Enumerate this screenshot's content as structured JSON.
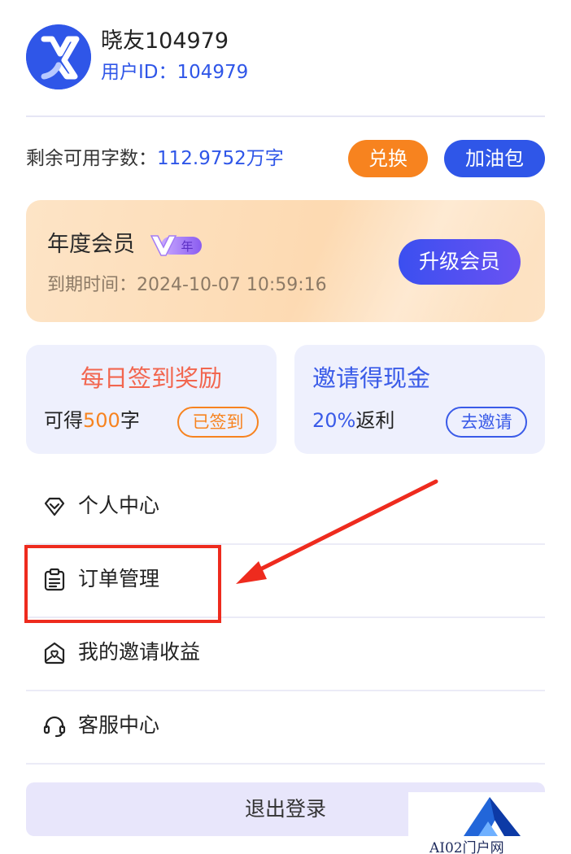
{
  "profile": {
    "username": "晓友104979",
    "user_id_label": "用户ID：",
    "user_id": "104979"
  },
  "quota": {
    "label": "剩余可用字数：",
    "value": "112.9752万字",
    "exchange_label": "兑换",
    "fuel_label": "加油包"
  },
  "membership": {
    "title": "年度会员",
    "badge_text": "年",
    "expire_label": "到期时间：",
    "expire_time": "2024-10-07 10:59:16",
    "upgrade_label": "升级会员"
  },
  "checkin": {
    "title": "每日签到奖励",
    "prefix": "可得",
    "amount": "500",
    "suffix": "字",
    "status_label": "已签到"
  },
  "invite": {
    "title": "邀请得现金",
    "percent": "20%",
    "suffix": "返利",
    "action_label": "去邀请"
  },
  "menu": {
    "items": [
      {
        "label": "个人中心",
        "icon": "diamond-icon"
      },
      {
        "label": "订单管理",
        "icon": "clipboard-icon"
      },
      {
        "label": "我的邀请收益",
        "icon": "envelope-heart-icon"
      },
      {
        "label": "客服中心",
        "icon": "headset-icon"
      }
    ]
  },
  "logout_label": "退出登录",
  "watermark_text": "AI02门户网",
  "colors": {
    "brand_blue": "#2f56e8",
    "orange": "#f7831f",
    "annotation_red": "#ee2b1e",
    "card_bg": "#eef0fd"
  }
}
